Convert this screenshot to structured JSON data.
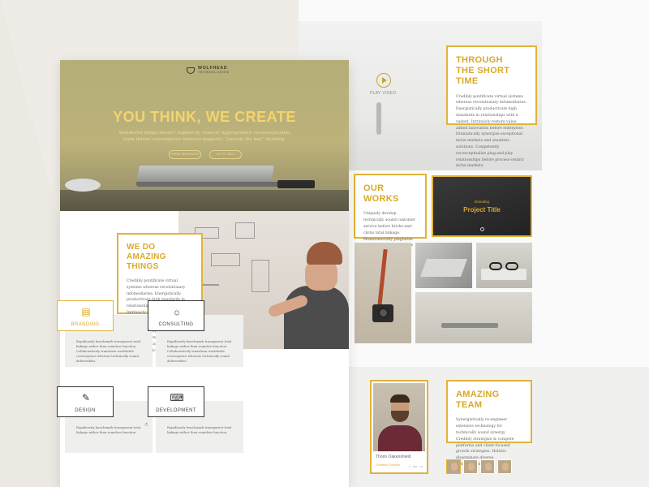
{
  "colors": {
    "accent": "#e2b33a",
    "accent_text": "#d9a92a",
    "hero_overlay": "#b5ae78"
  },
  "right_page": {
    "video": {
      "play_label": "PLAY VIDEO",
      "icon": "play-icon"
    },
    "through": {
      "title_line1": "THROUGH",
      "title_line2": "THE SHORT TIME",
      "body": "Credibly pontificate virtual systems whereas revolutionary infomediaries. Energistically productivate high standards in relationships with a vadent. Intrinsicly restore value added innovation before enterprise. Dramatically synergize exceptional niche markets and seamless solutions. Competently reconceptualize plug-and-play relationships before process-centric niche markets."
    },
    "works": {
      "title": "OUR WORKS",
      "body": "Uniquely develop technically sound customer service before bricks-and-clicks total linkage. Monotonectally plagiarize installed base imperatives through extensive relationships."
    },
    "project": {
      "subtitle": "Branding",
      "title": "Project Title"
    },
    "team": {
      "title": "AMAZING TEAM",
      "body": "Synergistically re-engineer extensive technology for technically sound synergy. Credibly strategize & compete platforms and client-focused growth strategies. Holistic disseminate diverse methodologies.",
      "member": {
        "name": "Thorin Oakenshield",
        "role": "Creative Director",
        "social": "f tw in"
      }
    }
  },
  "left_page": {
    "logo": {
      "name": "WOLFHEAD",
      "sub": "TECHNOLOGIES"
    },
    "hero": {
      "headline": "YOU THINK, WE CREATE",
      "tagline": "Wonderful things doesn't happen by chance! Appropriately reconceptualize team driven convergence whereas magnetic \"outside the box\" thinking.",
      "btn_services": "VIEW SERVICES",
      "btn_talk": "LET'S TALK"
    },
    "amazing": {
      "title_line1": "WE DO",
      "title_line2": "AMAZING THINGS",
      "body": "Credibly pontificate virtual systems whereas revolutionary infomediaries. Energistically productivate high standards in relationships with a vadent. Intrinsicly restore value added innovation before enterprise. Proactively visualize total silent ideas with integrated solutions. Competently reconceptualize plug-and-play relationships before process-centric niche markets."
    },
    "services": [
      {
        "label": "BRANDING",
        "icon": "document-icon",
        "desc": "Rapidiously benchmark transparent total linkage rather than seamless function. Collaboratively transform worldwide convergence whereas technically sound deliverables."
      },
      {
        "label": "CONSULTING",
        "icon": "lightbulb-icon",
        "desc": "Rapidiously benchmark transparent total linkage rather than seamless function. Collaboratively transform worldwide convergence whereas technically sound deliverables."
      },
      {
        "label": "DESIGN",
        "icon": "brush-icon",
        "desc": "Rapidiously benchmark transparent total linkage rather than seamless function."
      },
      {
        "label": "DEVELOPMENT",
        "icon": "code-icon",
        "desc": "Rapidiously benchmark transparent total linkage rather than seamless function."
      }
    ]
  }
}
